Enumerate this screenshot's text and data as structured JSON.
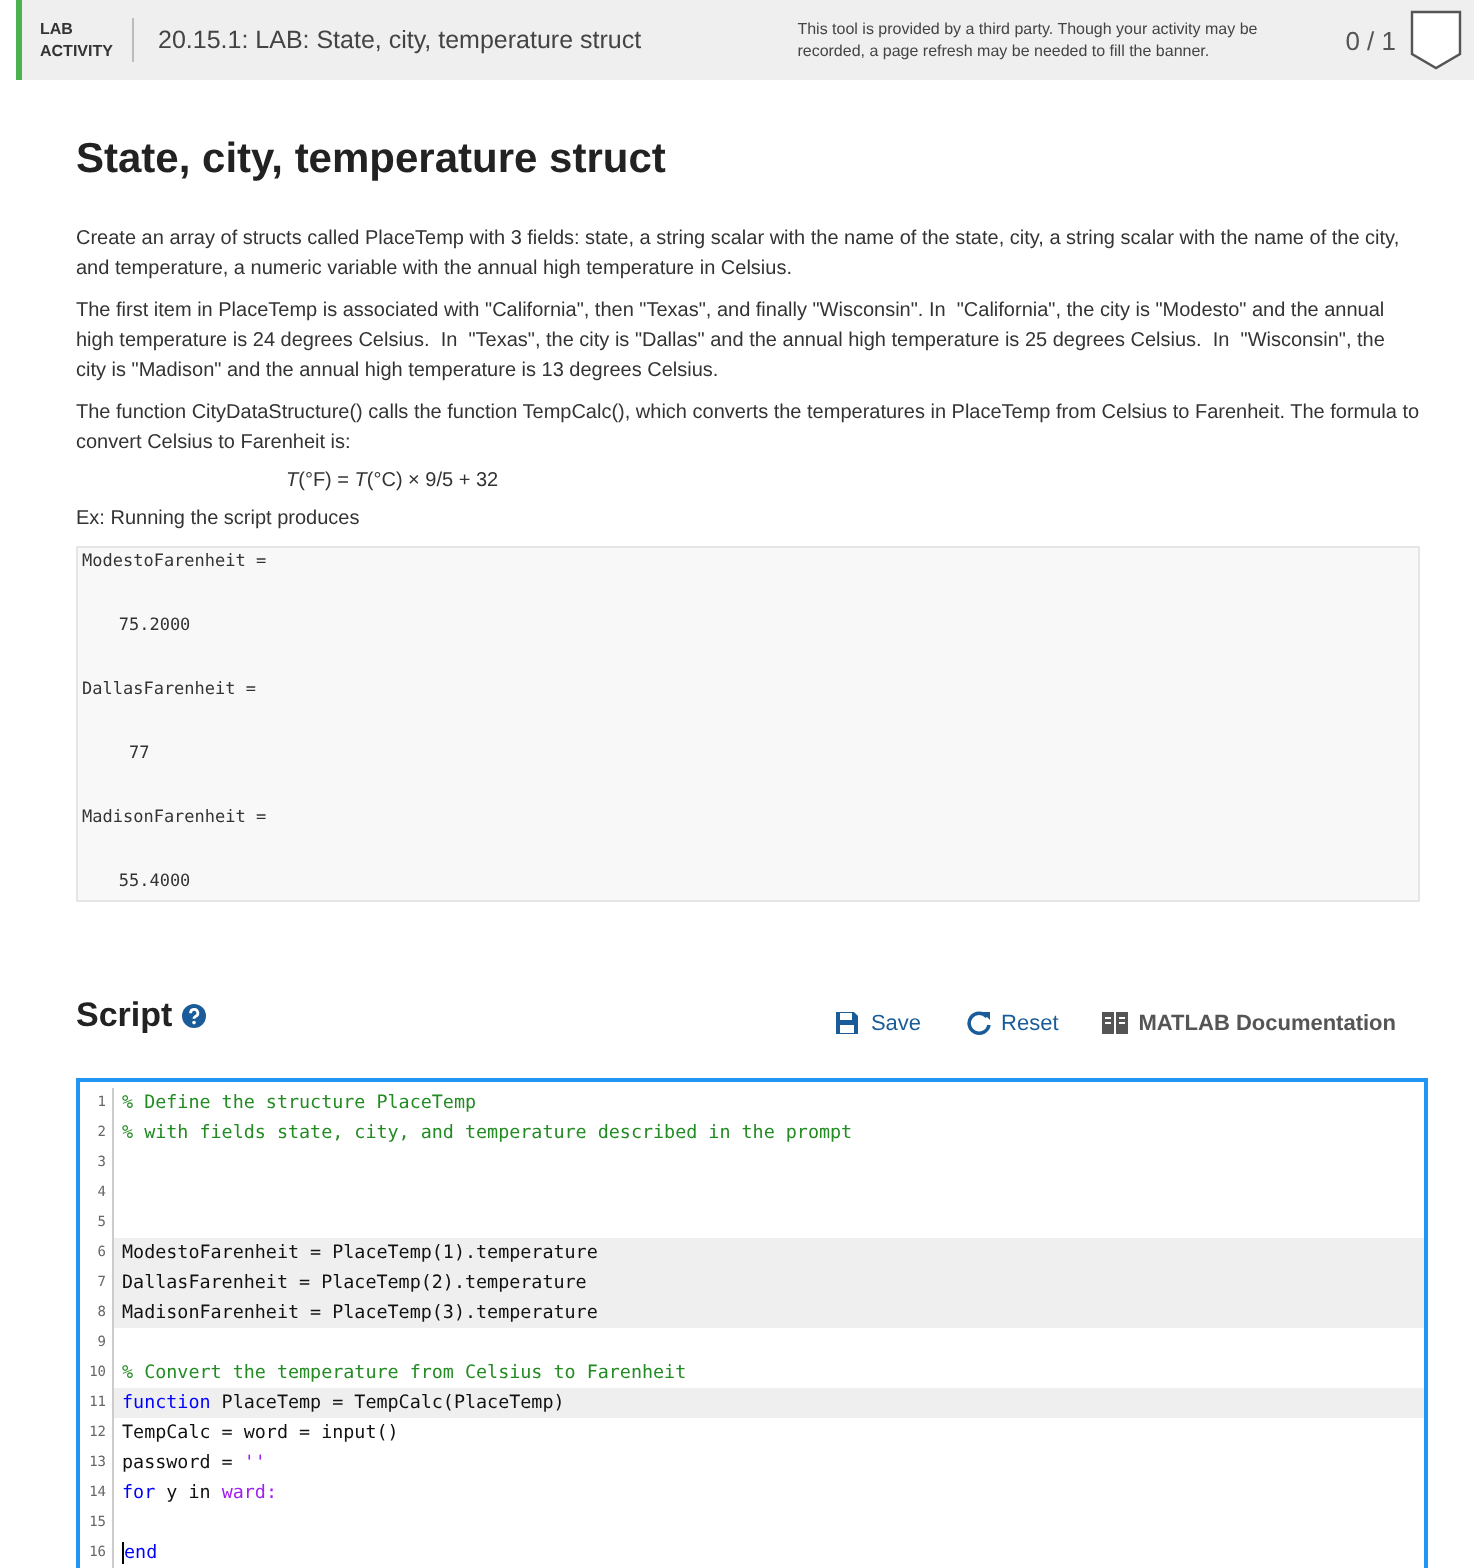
{
  "banner": {
    "label": "LAB ACTIVITY",
    "title": "20.15.1: LAB: State, city, temperature struct",
    "notice": "This tool is provided by a third party. Though your activity may be recorded, a page refresh may be needed to fill the banner.",
    "score": "0 / 1"
  },
  "heading": "State, city, temperature struct",
  "paragraphs": [
    {
      "kind": "text",
      "text": "Create an array of structs called PlaceTemp with 3 fields: state, a string scalar with the name of the state, city, a string scalar with the name of the city, and temperature, a numeric variable with the annual high temperature in Celsius."
    },
    {
      "kind": "text",
      "text": "The first item in PlaceTemp is associated with \"California\", then \"Texas\", and finally \"Wisconsin\". In  \"California\", the city is \"Modesto\" and the annual high temperature is 24 degrees Celsius.  In  \"Texas\", the city is \"Dallas\" and the annual high temperature is 25 degrees Celsius.  In  \"Wisconsin\", the city is \"Madison\" and the annual high temperature is 13 degrees Celsius."
    },
    {
      "kind": "text",
      "text": "The function CityDataStructure() calls the function TempCalc(), which converts the temperatures in PlaceTemp from Celsius to Farenheit. The formula to convert Celsius to Farenheit is:"
    },
    {
      "kind": "formula",
      "text": "*T*(°F) = *T*(°C) × 9/5 + 32"
    },
    {
      "kind": "text",
      "text": "Ex: Running the script produces"
    }
  ],
  "output_lines": [
    {
      "kind": "name",
      "text": "ModestoFarenheit ="
    },
    {
      "kind": "value",
      "text": "   75.2000"
    },
    {
      "kind": "name",
      "text": "DallasFarenheit ="
    },
    {
      "kind": "value",
      "text": "    77"
    },
    {
      "kind": "name",
      "text": "MadisonFarenheit ="
    },
    {
      "kind": "value",
      "text": "   55.4000"
    }
  ],
  "script": {
    "title": "Script",
    "actions": [
      {
        "kind": "save",
        "label": "Save"
      },
      {
        "kind": "reset",
        "label": "Reset"
      },
      {
        "kind": "docs",
        "label": "MATLAB Documentation"
      }
    ],
    "lines": [
      {
        "number": "1",
        "highlighted": false,
        "tokens": [
          {
            "kind": "comment",
            "text": "% Define the structure PlaceTemp"
          }
        ]
      },
      {
        "number": "2",
        "highlighted": false,
        "tokens": [
          {
            "kind": "comment",
            "text": "% with fields state, city, and temperature described in the prompt"
          }
        ]
      },
      {
        "number": "3",
        "highlighted": false
      },
      {
        "number": "4",
        "highlighted": false
      },
      {
        "number": "5",
        "highlighted": false
      },
      {
        "number": "6",
        "highlighted": true,
        "tokens": [
          {
            "kind": "plain",
            "text": "ModestoFarenheit = PlaceTemp(1).temperature"
          }
        ]
      },
      {
        "number": "7",
        "highlighted": true,
        "tokens": [
          {
            "kind": "plain",
            "text": "DallasFarenheit = PlaceTemp(2).temperature"
          }
        ]
      },
      {
        "number": "8",
        "highlighted": true,
        "tokens": [
          {
            "kind": "plain",
            "text": "MadisonFarenheit = PlaceTemp(3).temperature"
          }
        ]
      },
      {
        "number": "9",
        "highlighted": false
      },
      {
        "number": "10",
        "highlighted": false,
        "tokens": [
          {
            "kind": "comment",
            "text": "% Convert the temperature from Celsius to Farenheit"
          }
        ]
      },
      {
        "number": "11",
        "highlighted": true,
        "tokens": [
          {
            "kind": "keyword",
            "text": "function"
          },
          {
            "kind": "plain",
            "text": " PlaceTemp = TempCalc(PlaceTemp)"
          }
        ]
      },
      {
        "number": "12",
        "highlighted": false,
        "tokens": [
          {
            "kind": "plain",
            "text": "TempCalc = word = input()"
          }
        ]
      },
      {
        "number": "13",
        "highlighted": false,
        "tokens": [
          {
            "kind": "plain",
            "text": "password = "
          },
          {
            "kind": "string",
            "text": "''"
          }
        ]
      },
      {
        "number": "14",
        "highlighted": false,
        "tokens": [
          {
            "kind": "keyword",
            "text": "for"
          },
          {
            "kind": "plain",
            "text": " y in "
          },
          {
            "kind": "string",
            "text": "ward:"
          }
        ]
      },
      {
        "number": "15",
        "highlighted": false
      },
      {
        "number": "16",
        "highlighted": false,
        "cursor": true,
        "tokens": [
          {
            "kind": "keyword",
            "text": "end"
          }
        ]
      }
    ]
  }
}
